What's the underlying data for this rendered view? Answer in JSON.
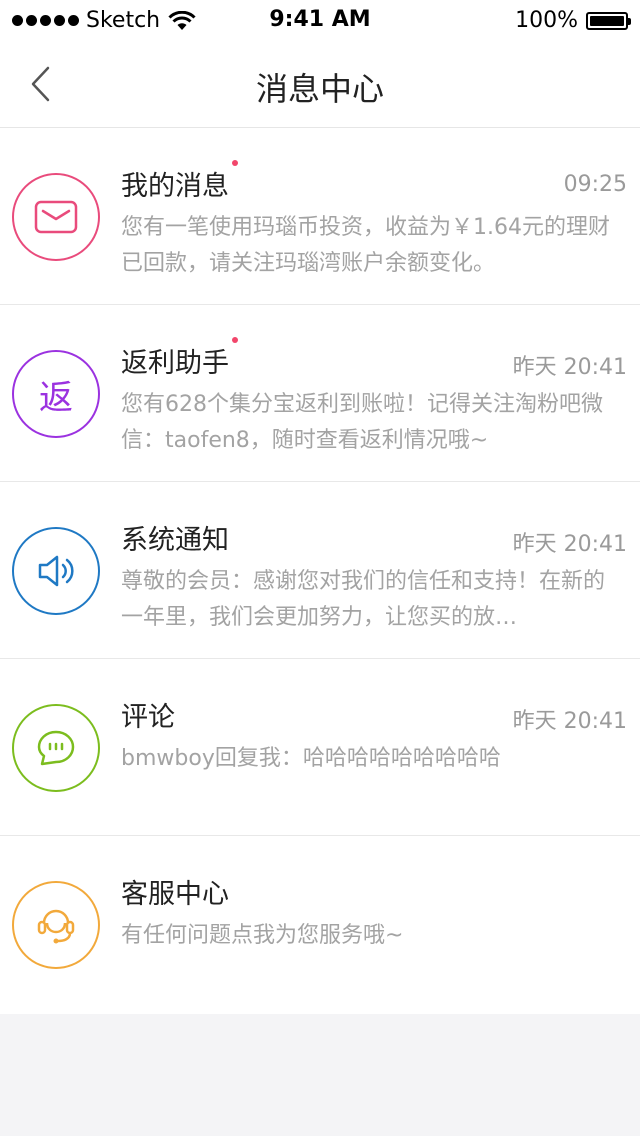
{
  "status_bar": {
    "carrier": "Sketch",
    "time": "9:41 AM",
    "battery": "100%"
  },
  "nav": {
    "title": "消息中心",
    "back_icon": "chevron-left-icon"
  },
  "messages": [
    {
      "title": "我的消息",
      "time": "09:25",
      "unread": true,
      "icon": "mail-icon",
      "color": "#e94b7c",
      "body": "您有一笔使用玛瑙币投资，收益为￥1.64元的理财已回款，请关注玛瑙湾账户余额变化。"
    },
    {
      "title": "返利助手",
      "time": "昨天 20:41",
      "unread": true,
      "icon": "rebate-icon",
      "icon_text": "返",
      "color": "#9b32e0",
      "body": "您有628个集分宝返利到账啦！记得关注淘粉吧微信：taofen8，随时查看返利情况哦~"
    },
    {
      "title": "系统通知",
      "time": "昨天 20:41",
      "unread": false,
      "icon": "speaker-icon",
      "color": "#1f79c4",
      "body": "尊敬的会员：感谢您对我们的信任和支持！在新的一年里，我们会更加努力，让您买的放…"
    },
    {
      "title": "评论",
      "time": "昨天 20:41",
      "unread": false,
      "icon": "chat-bubble-icon",
      "color": "#7cbd1e",
      "body": "bmwboy回复我：哈哈哈哈哈哈哈哈哈"
    },
    {
      "title": "客服中心",
      "time": "",
      "unread": false,
      "icon": "headset-icon",
      "color": "#f2a93b",
      "body": "有任何问题点我为您服务哦~"
    }
  ]
}
